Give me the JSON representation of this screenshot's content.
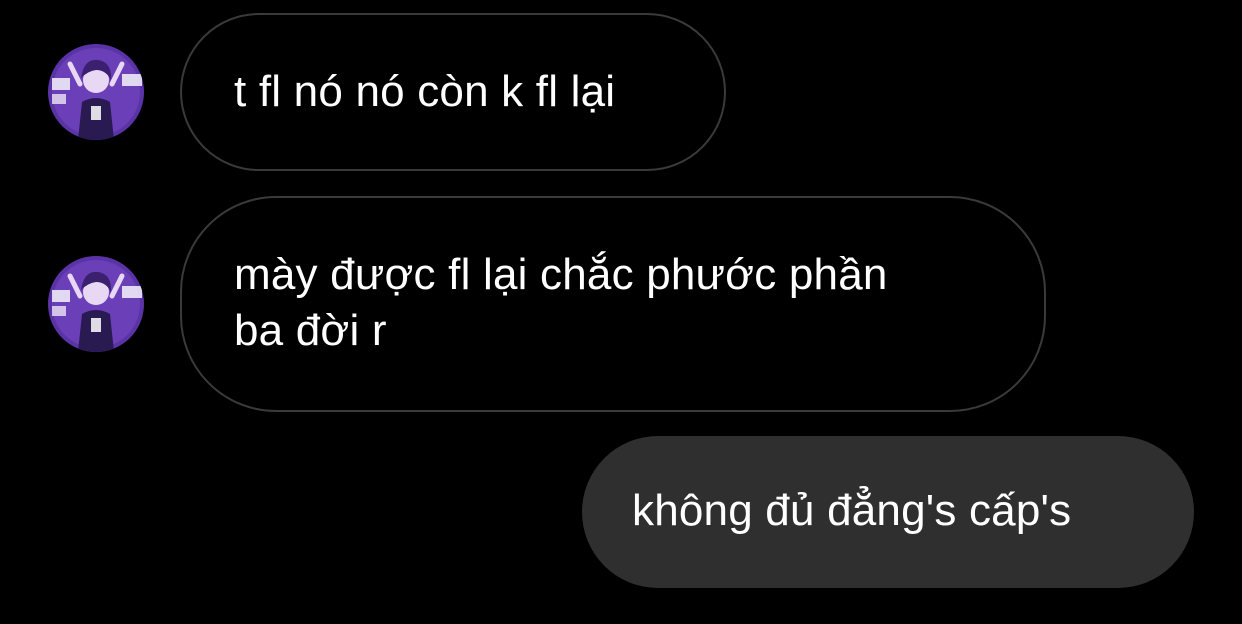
{
  "conversation": {
    "messages": [
      {
        "direction": "received",
        "text": "t fl nó nó còn k fl lại",
        "avatar": "avatar-anime-purple"
      },
      {
        "direction": "received",
        "text": "mày được fl lại chắc phước phần\nba đời r",
        "avatar": "avatar-anime-purple"
      },
      {
        "direction": "sent",
        "text": "không đủ đẳng's cấp's"
      }
    ]
  },
  "colors": {
    "background": "#000000",
    "received_bubble_border": "#3a3a3a",
    "sent_bubble_fill": "#2f2f2f",
    "text": "#ffffff",
    "avatar_accent": "#6b3fb8"
  }
}
